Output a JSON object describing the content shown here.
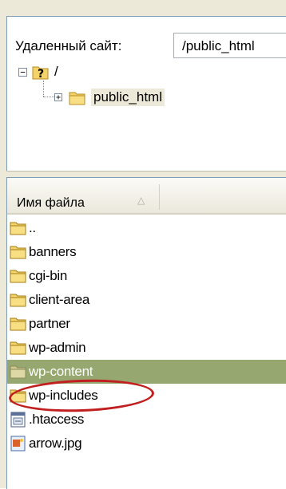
{
  "remote_site": {
    "label": "Удаленный сайт:",
    "path": "/public_html"
  },
  "tree": {
    "root_label": "/",
    "child_label": "public_html"
  },
  "file_list": {
    "column_header": "Имя файла",
    "sort_indicator": "sort-ascending-icon",
    "rows": [
      {
        "name": "..",
        "icon": "folder-icon"
      },
      {
        "name": "banners",
        "icon": "folder-icon"
      },
      {
        "name": "cgi-bin",
        "icon": "folder-icon"
      },
      {
        "name": "client-area",
        "icon": "folder-icon"
      },
      {
        "name": "partner",
        "icon": "folder-icon"
      },
      {
        "name": "wp-admin",
        "icon": "folder-icon"
      },
      {
        "name": "wp-content",
        "icon": "folder-icon",
        "selected": true
      },
      {
        "name": "wp-includes",
        "icon": "folder-icon"
      },
      {
        "name": ".htaccess",
        "icon": "config-file-icon"
      },
      {
        "name": "arrow.jpg",
        "icon": "image-file-icon"
      }
    ]
  },
  "colors": {
    "selection": "#96a86f",
    "annotation_circle": "#c11f1f",
    "folder": "#f3d36a"
  }
}
